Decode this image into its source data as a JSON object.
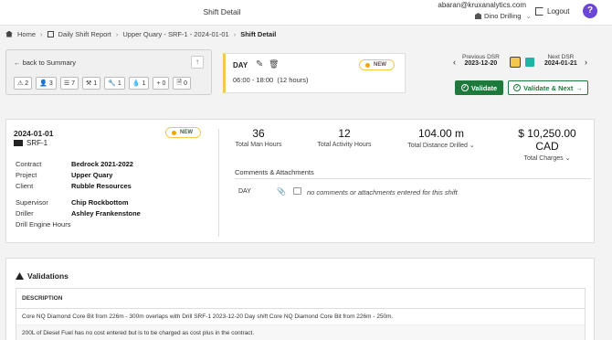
{
  "header": {
    "title": "Shift Detail",
    "user_email": "abaran@kruxanalytics.com",
    "company": "Dino Drilling",
    "logout_label": "Logout",
    "help_label": "?"
  },
  "breadcrumb": [
    {
      "label": "Home"
    },
    {
      "label": "Daily Shift Report"
    },
    {
      "label": "Upper Quary - SRF-1 - 2024-01-01"
    },
    {
      "label": "Shift Detail"
    }
  ],
  "summary_nav": {
    "back_label": "back to Summary",
    "up_label": "↑",
    "chips": [
      {
        "icon": "warning-icon",
        "glyph": "⚠",
        "count": "2"
      },
      {
        "icon": "person-icon",
        "glyph": "👤",
        "count": "3"
      },
      {
        "icon": "list-icon",
        "glyph": "☰",
        "count": "7"
      },
      {
        "icon": "tool-icon",
        "glyph": "⚒",
        "count": "1"
      },
      {
        "icon": "wrench-icon",
        "glyph": "🔧",
        "count": "1"
      },
      {
        "icon": "fuel-icon",
        "glyph": "💧",
        "count": "1"
      },
      {
        "icon": "plus-icon",
        "glyph": "+",
        "count": "0"
      },
      {
        "icon": "document-icon",
        "glyph": "🗎",
        "count": "0"
      }
    ]
  },
  "shift_card": {
    "day_label": "DAY",
    "status": "NEW",
    "time_range": "06:00 - 18:00",
    "duration": "(12 hours)"
  },
  "dsr_nav": {
    "previous_label": "Previous DSR",
    "previous_date": "2023-12-20",
    "next_label": "Next DSR",
    "next_date": "2024-01-21",
    "colors": {
      "current": "#f2c94c",
      "other": "#1fb5a5"
    }
  },
  "actions": {
    "validate_label": "Validate",
    "validate_next_label": "Validate & Next"
  },
  "shift": {
    "date": "2024-01-01",
    "rig": "SRF-1",
    "status": "NEW",
    "fields": [
      {
        "label": "Contract",
        "value": "Bedrock 2021-2022"
      },
      {
        "label": "Project",
        "value": "Upper Quary"
      },
      {
        "label": "Client",
        "value": "Rubble Resources"
      }
    ],
    "people": [
      {
        "label": "Supervisor",
        "value": "Chip Rockbottom"
      },
      {
        "label": "Driller",
        "value": "Ashley Frankenstone"
      },
      {
        "label": "Drill Engine Hours",
        "value": ""
      }
    ]
  },
  "stats": [
    {
      "value": "36",
      "label": "Total Man Hours"
    },
    {
      "value": "12",
      "label": "Total Activity Hours"
    },
    {
      "value": "104.00 m",
      "label": "Total Distance Drilled"
    },
    {
      "value": "$ 10,250.00 CAD",
      "label": "Total Charges"
    }
  ],
  "comments": {
    "title": "Comments & Attachments",
    "shift_label": "DAY",
    "message": "no comments or attachments entered for this shift"
  },
  "validations": {
    "title": "Validations",
    "column": "DESCRIPTION",
    "rows": [
      "Core NQ Diamond Core Bit from 226m - 300m overlaps with Drill SRF-1 2023-12-20 Day shift Core NQ Diamond Core Bit from 226m - 250m.",
      "200L of Diesel Fuel has no cost entered but is to be charged as cost plus in the contract."
    ]
  }
}
